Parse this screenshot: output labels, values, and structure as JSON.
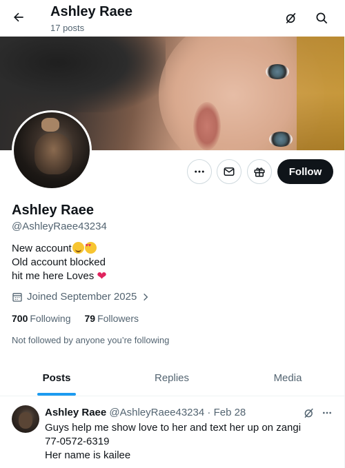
{
  "header": {
    "title": "Ashley Raee",
    "post_count": "17 posts"
  },
  "actions": {
    "follow_label": "Follow"
  },
  "profile": {
    "name": "Ashley Raee",
    "handle": "@AshleyRaee43234",
    "bio_lines": [
      "New account",
      "Old account blocked",
      "hit me here Loves"
    ],
    "joined": "Joined September 2025",
    "following_count": "700",
    "following_label": "Following",
    "followers_count": "79",
    "followers_label": "Followers",
    "not_followed_text": "Not followed by anyone you’re following"
  },
  "tabs": [
    {
      "label": "Posts",
      "active": true
    },
    {
      "label": "Replies",
      "active": false
    },
    {
      "label": "Media",
      "active": false
    }
  ],
  "post": {
    "author": "Ashley Raee",
    "handle": "@AshleyRaee43234",
    "separator": "·",
    "date": "Feb 28",
    "lines": [
      "Guys help me show love to her and text her up on zangi",
      "77-0572-6319",
      "Her name is kailee"
    ]
  },
  "colors": {
    "accent": "#1d9bf0",
    "text_primary": "#0f1419",
    "text_secondary": "#536471",
    "follow_bg": "#0f1419"
  },
  "icons": [
    "back-arrow-icon",
    "grok-icon",
    "search-icon",
    "more-icon",
    "message-icon",
    "gift-icon",
    "calendar-icon",
    "chevron-right-icon",
    "smiling-face-emoji-icon",
    "heart-eyes-emoji-icon",
    "red-heart-icon"
  ]
}
